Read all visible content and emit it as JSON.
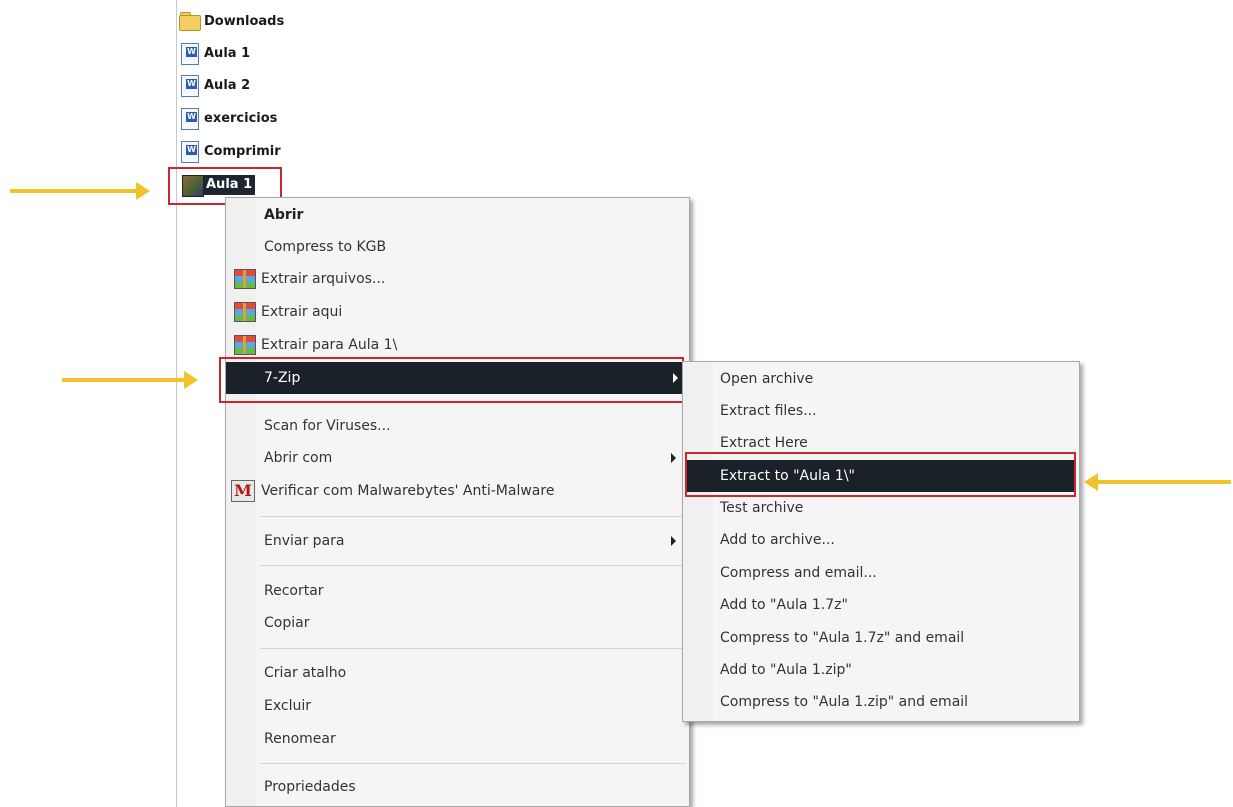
{
  "file_list": [
    {
      "name": "Downloads",
      "icon": "folder-icon"
    },
    {
      "name": "Aula 1",
      "icon": "word-document-icon"
    },
    {
      "name": "Aula 2",
      "icon": "word-document-icon"
    },
    {
      "name": "exercicios",
      "icon": "word-document-icon"
    },
    {
      "name": "Comprimir",
      "icon": "word-document-icon"
    }
  ],
  "selected_file": {
    "name": "Aula 1",
    "icon": "archive-icon"
  },
  "context_menu": {
    "items": [
      {
        "label": "Abrir"
      },
      {
        "label": "Compress to KGB"
      },
      {
        "label": "Extrair arquivos...",
        "icon": "winrar-icon"
      },
      {
        "label": "Extrair aqui",
        "icon": "winrar-icon"
      },
      {
        "label": "Extrair para Aula 1\\",
        "icon": "winrar-icon"
      },
      {
        "label": "7-Zip",
        "has_submenu": true
      },
      {
        "label": "Scan for Viruses..."
      },
      {
        "label": "Abrir com",
        "has_submenu": true
      },
      {
        "label": "Verificar com Malwarebytes' Anti-Malware",
        "icon": "malwarebytes-icon"
      },
      {
        "label": "Enviar para",
        "has_submenu": true
      },
      {
        "label": "Recortar"
      },
      {
        "label": "Copiar"
      },
      {
        "label": "Criar atalho"
      },
      {
        "label": "Excluir"
      },
      {
        "label": "Renomear"
      },
      {
        "label": "Propriedades"
      }
    ]
  },
  "submenu_7zip": {
    "items": [
      {
        "label": "Open archive"
      },
      {
        "label": "Extract files..."
      },
      {
        "label": "Extract Here"
      },
      {
        "label": "Extract to \"Aula 1\\\""
      },
      {
        "label": "Test archive"
      },
      {
        "label": "Add to archive..."
      },
      {
        "label": "Compress and email..."
      },
      {
        "label": "Add to \"Aula 1.7z\""
      },
      {
        "label": "Compress to \"Aula 1.7z\" and email"
      },
      {
        "label": "Add to \"Aula 1.zip\""
      },
      {
        "label": "Compress to \"Aula 1.zip\" and email"
      }
    ]
  },
  "colors": {
    "highlight": "#1b2129",
    "annotation_box": "#c9262d",
    "annotation_arrow": "#f2c229",
    "menu_bg": "#f5f5f5"
  }
}
